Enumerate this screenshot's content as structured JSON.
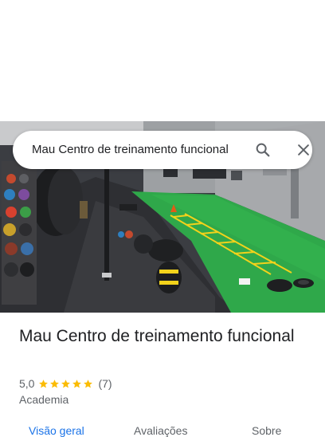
{
  "search": {
    "query": "Mau Centro de treinamento funcional"
  },
  "icons": {
    "search": "search-icon",
    "close": "close-icon",
    "star": "star-icon"
  },
  "colors": {
    "accent": "#1a73e8",
    "star": "#fbbc04",
    "turf": "#2fa84a"
  },
  "place": {
    "name": "Mau Centro de treinamento funcional",
    "rating": "5,0",
    "stars": 5,
    "review_count": "(7)",
    "category": "Academia"
  },
  "tabs": [
    {
      "label": "Visão geral",
      "active": true
    },
    {
      "label": "Avaliações",
      "active": false
    },
    {
      "label": "Sobre",
      "active": false
    }
  ]
}
